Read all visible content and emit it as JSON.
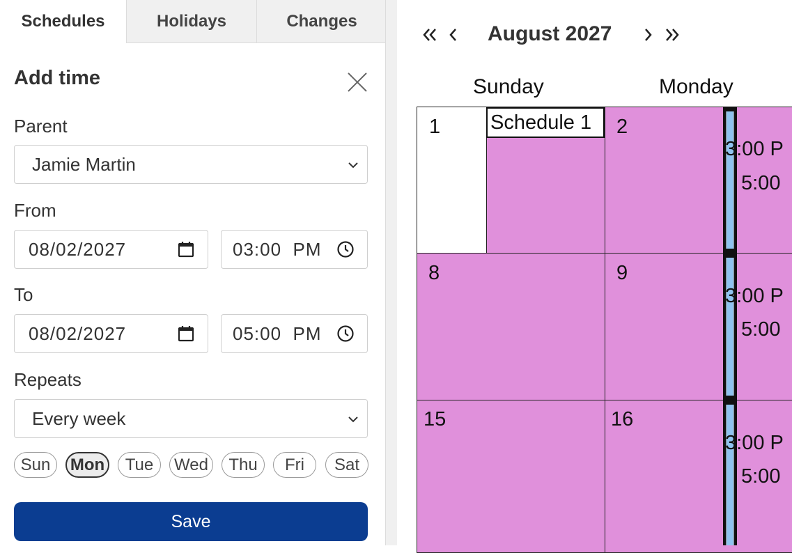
{
  "tabs": [
    {
      "label": "Schedules",
      "active": true
    },
    {
      "label": "Holidays",
      "active": false
    },
    {
      "label": "Changes",
      "active": false
    }
  ],
  "form": {
    "title": "Add time",
    "parent_label": "Parent",
    "parent_value": "Jamie Martin",
    "from_label": "From",
    "from_date": "08/02/2027",
    "from_time": "03:00  PM",
    "to_label": "To",
    "to_date": "08/02/2027",
    "to_time": "05:00  PM",
    "repeats_label": "Repeats",
    "repeats_value": "Every week",
    "days": [
      {
        "label": "Sun",
        "selected": false
      },
      {
        "label": "Mon",
        "selected": true
      },
      {
        "label": "Tue",
        "selected": false
      },
      {
        "label": "Wed",
        "selected": false
      },
      {
        "label": "Thu",
        "selected": false
      },
      {
        "label": "Fri",
        "selected": false
      },
      {
        "label": "Sat",
        "selected": false
      }
    ],
    "save_label": "Save"
  },
  "calendar": {
    "month_title": "August 2027",
    "weekdays": [
      "Sunday",
      "Monday"
    ],
    "event_title": "Schedule 1",
    "event_start_text": "3:00 P",
    "event_end_text": "5:00",
    "weeks": [
      {
        "sunday": "1",
        "monday": "2"
      },
      {
        "sunday": "8",
        "monday": "9"
      },
      {
        "sunday": "15",
        "monday": "16"
      }
    ]
  },
  "colors": {
    "schedule_fill": "#e090db",
    "event_bar": "#8fc3f0",
    "save_button": "#0b3d91"
  }
}
